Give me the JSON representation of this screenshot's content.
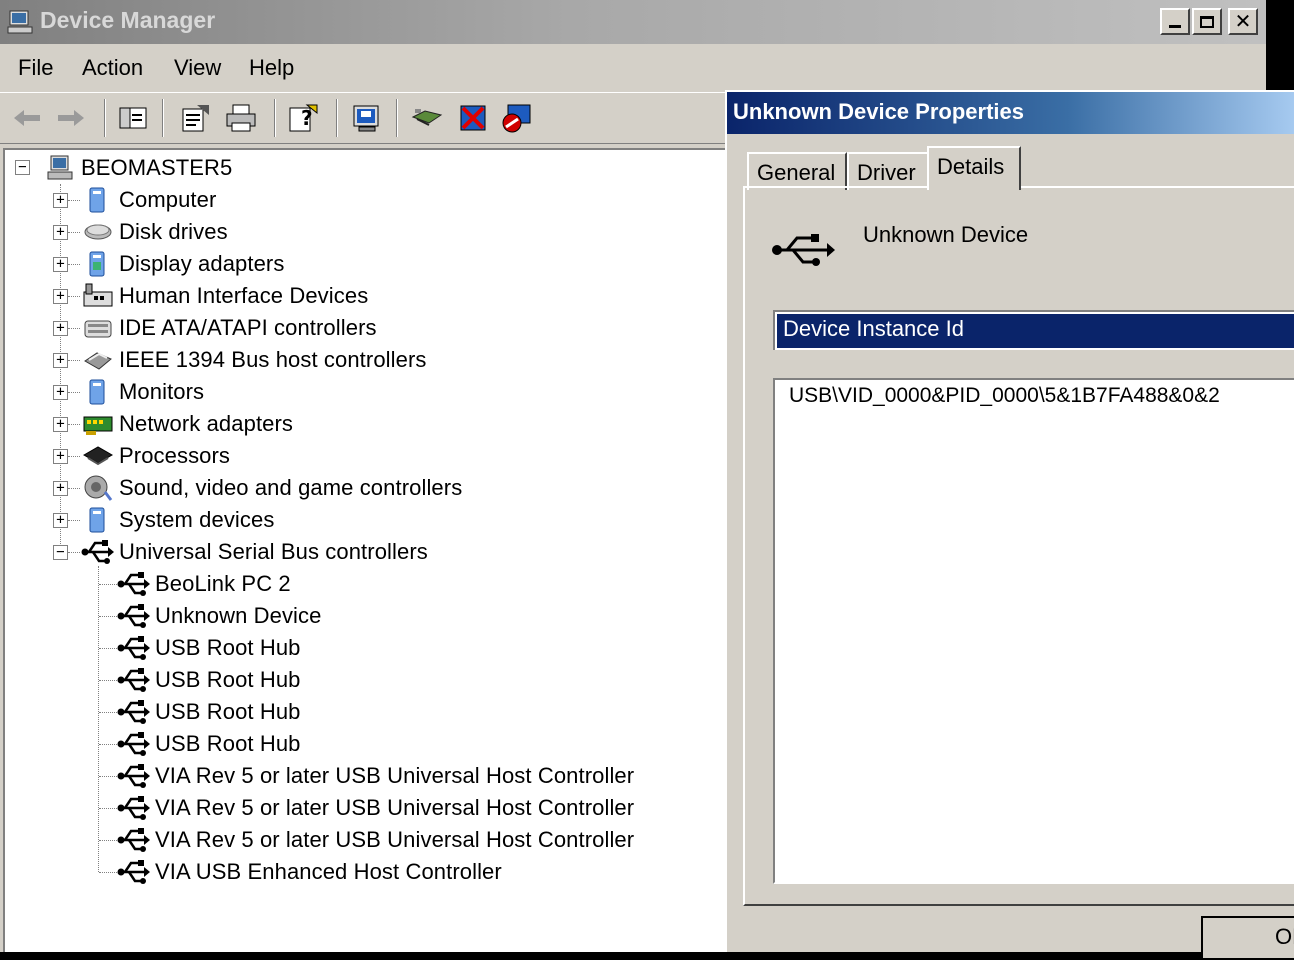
{
  "device_manager": {
    "title": "Device Manager",
    "menu": [
      "File",
      "Action",
      "View",
      "Help"
    ],
    "toolbar": [
      "back-arrow-icon",
      "forward-arrow-icon",
      "show-hide-console-tree-icon",
      "properties-icon",
      "print-icon",
      "help-icon",
      "monitor-icon",
      "scan-hardware-icon",
      "uninstall-icon",
      "disable-icon"
    ],
    "tree": {
      "root": "BEOMASTER5",
      "categories": [
        {
          "label": "Computer",
          "icon": "computer-icon",
          "expanded": false
        },
        {
          "label": "Disk drives",
          "icon": "disk-drive-icon",
          "expanded": false
        },
        {
          "label": "Display adapters",
          "icon": "display-adapter-icon",
          "expanded": false
        },
        {
          "label": "Human Interface Devices",
          "icon": "hid-icon",
          "expanded": false
        },
        {
          "label": "IDE ATA/ATAPI controllers",
          "icon": "ide-controller-icon",
          "expanded": false
        },
        {
          "label": "IEEE 1394 Bus host controllers",
          "icon": "ieee1394-icon",
          "expanded": false
        },
        {
          "label": "Monitors",
          "icon": "monitor-icon",
          "expanded": false
        },
        {
          "label": "Network adapters",
          "icon": "network-adapter-icon",
          "expanded": false
        },
        {
          "label": "Processors",
          "icon": "processor-icon",
          "expanded": false
        },
        {
          "label": "Sound, video and game controllers",
          "icon": "sound-icon",
          "expanded": false
        },
        {
          "label": "System devices",
          "icon": "system-device-icon",
          "expanded": false
        },
        {
          "label": "Universal Serial Bus controllers",
          "icon": "usb-icon",
          "expanded": true
        }
      ],
      "usb_children": [
        "BeoLink PC 2",
        "Unknown Device",
        "USB Root Hub",
        "USB Root Hub",
        "USB Root Hub",
        "USB Root Hub",
        "VIA Rev 5 or later USB Universal Host Controller",
        "VIA Rev 5 or later USB Universal Host Controller",
        "VIA Rev 5 or later USB Universal Host Controller",
        "VIA USB Enhanced Host Controller"
      ]
    }
  },
  "dialog": {
    "title": "Unknown Device Properties",
    "tabs": [
      "General",
      "Driver",
      "Details"
    ],
    "active_tab": "Details",
    "device_name": "Unknown Device",
    "property_selected": "Device Instance Id",
    "property_value": "USB\\VID_0000&PID_0000\\5&1B7FA488&0&2",
    "ok_label": "OK"
  }
}
